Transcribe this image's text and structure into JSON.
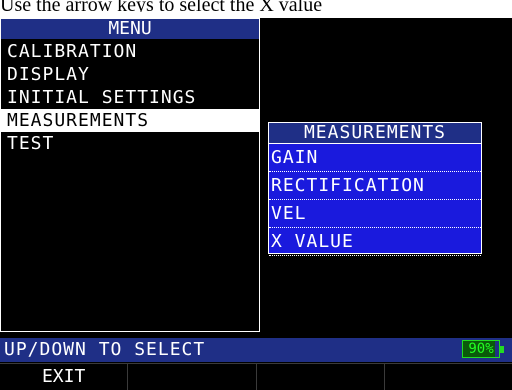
{
  "caption": "Use the arrow keys to select the X value",
  "menu": {
    "title": "MENU",
    "items": [
      {
        "label": "CALIBRATION"
      },
      {
        "label": "DISPLAY"
      },
      {
        "label": "INITIAL SETTINGS"
      },
      {
        "label": "MEASUREMENTS"
      },
      {
        "label": "TEST"
      }
    ],
    "selected_index": 3
  },
  "submenu": {
    "title": "MEASUREMENTS",
    "items": [
      {
        "label": "GAIN"
      },
      {
        "label": "RECTIFICATION"
      },
      {
        "label": "VEL"
      },
      {
        "label": "X VALUE"
      }
    ]
  },
  "status": {
    "text": "UP/DOWN TO SELECT",
    "battery_percent_label": "90%",
    "battery_level": 0.9
  },
  "softkeys": [
    {
      "label": "EXIT"
    },
    {
      "label": ""
    },
    {
      "label": ""
    },
    {
      "label": ""
    }
  ],
  "colors": {
    "screen_bg": "#000000",
    "title_bar": "#1f2f86",
    "submenu_bg": "#1a1add",
    "battery": "#22dd22"
  }
}
